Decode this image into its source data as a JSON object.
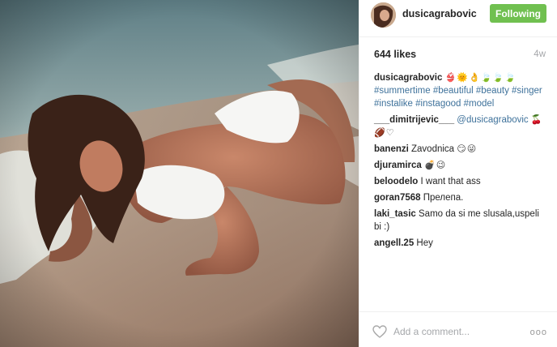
{
  "post": {
    "username": "dusicagrabovic",
    "follow_label": "Following",
    "likes": "644 likes",
    "age": "4w"
  },
  "caption": {
    "user": "dusicagrabovic",
    "emoji": "👙🌞👌🍃🍃🍃",
    "tags_line1": "#summertime #beautiful #beauty #singer",
    "tags_line2": "#instalike #instagood #model"
  },
  "comments": [
    {
      "user": "___dimitrijevic___",
      "mention": "@dusicagrabovic",
      "emoji": "🍒🏈♡"
    },
    {
      "user": "banenzi",
      "text": "Zavodnica",
      "emoji": "😏😜"
    },
    {
      "user": "djuramirca",
      "text": "",
      "emoji": "💣😉"
    },
    {
      "user": "beloodelo",
      "text": "I want that ass",
      "emoji": ""
    },
    {
      "user": "goran7568",
      "text": "Прелепа.",
      "emoji": ""
    },
    {
      "user": "laki_tasic",
      "text": "Samo da si me slusala,uspeli bi :)",
      "emoji": ""
    },
    {
      "user": "angell.25",
      "text": "Hey",
      "emoji": ""
    }
  ],
  "footer": {
    "add_comment_placeholder": "Add a comment...",
    "more_label": "ooo"
  },
  "icons": {
    "like": "heart-icon",
    "more": "more-options-icon"
  },
  "colors": {
    "follow_bg": "#70c050",
    "hashtag": "#3f729b"
  }
}
